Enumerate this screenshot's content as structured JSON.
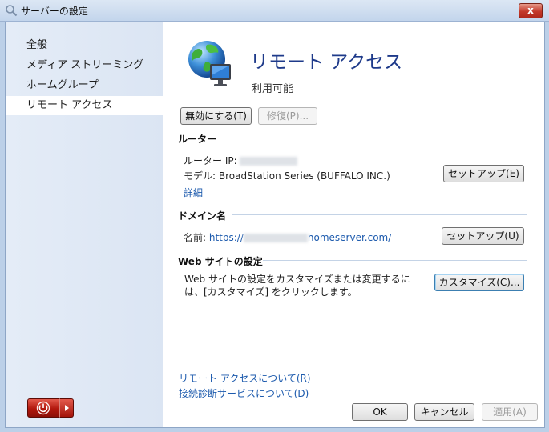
{
  "window": {
    "title": "サーバーの設定",
    "close_label": "x"
  },
  "sidebar": {
    "items": [
      {
        "label": "全般"
      },
      {
        "label": "メディア ストリーミング"
      },
      {
        "label": "ホームグループ"
      },
      {
        "label": "リモート アクセス",
        "selected": true
      }
    ]
  },
  "main": {
    "title": "リモート アクセス",
    "status": "利用可能",
    "disable_button": "無効にする(T)",
    "repair_button": "修復(P)...",
    "router": {
      "header": "ルーター",
      "ip_label": "ルーター IP:",
      "model_text": "モデル: BroadStation Series (BUFFALO INC.)",
      "details_link": "詳細",
      "setup_button": "セットアップ(E)"
    },
    "domain": {
      "header": "ドメイン名",
      "name_label": "名前:",
      "url_prefix": "https://",
      "url_suffix": "homeserver.com/",
      "setup_button": "セットアップ(U)"
    },
    "website": {
      "header": "Web サイトの設定",
      "description": "Web サイトの設定をカスタマイズまたは変更するには、[カスタマイズ] をクリックします。",
      "customize_button": "カスタマイズ(C)..."
    },
    "links": {
      "about_remote": "リモート アクセスについて(R)",
      "about_diagnostics": "接続診断サービスについて(D)"
    },
    "footer": {
      "ok": "OK",
      "cancel": "キャンセル",
      "apply": "適用(A)"
    }
  },
  "colors": {
    "accent_title": "#1e3a8a",
    "link": "#1c5aad",
    "close_red": "#c3392a",
    "power_red": "#b2170c"
  },
  "icons": [
    "search-icon",
    "globe-monitor-icon",
    "power-icon",
    "arrow-right-icon"
  ]
}
